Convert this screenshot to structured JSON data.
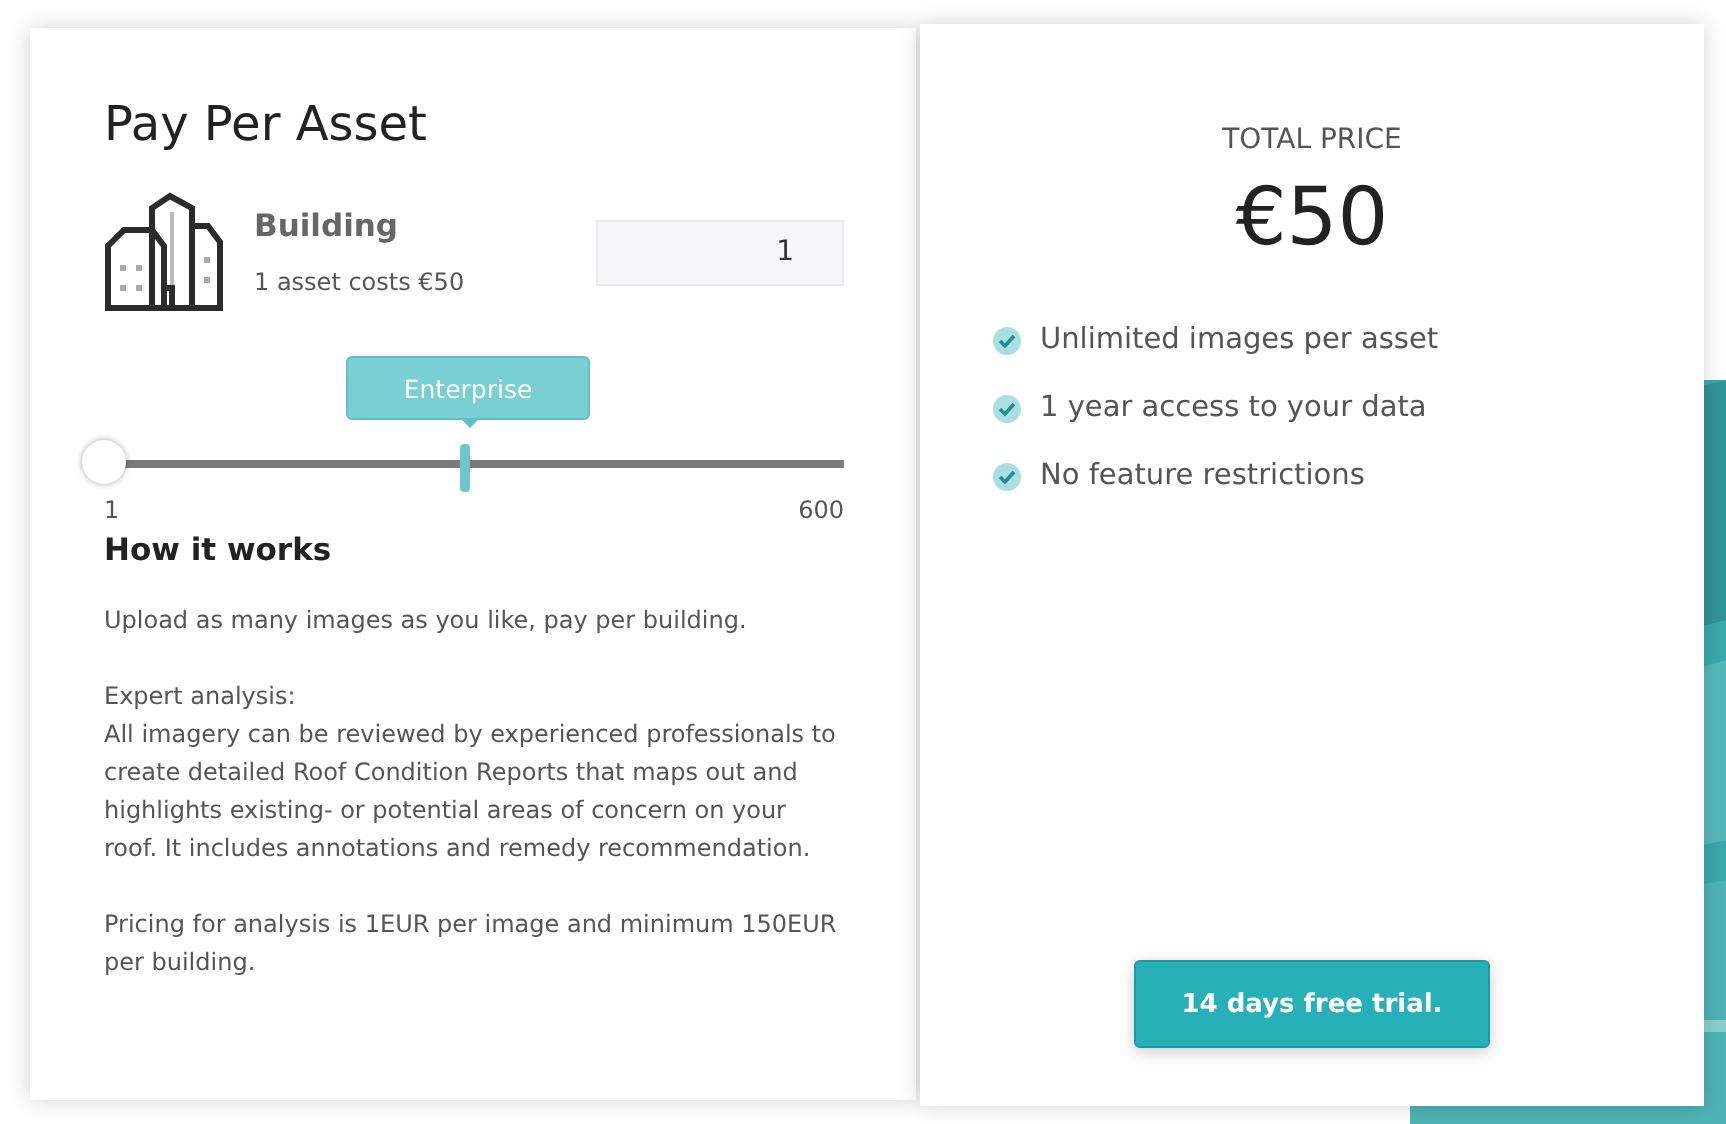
{
  "plan": {
    "title": "Pay Per Asset",
    "asset": {
      "name": "Building",
      "cost": "1 asset costs €50",
      "quantity": "1"
    },
    "slider": {
      "level": 0,
      "marker": "Enterprise",
      "min": "1",
      "max": "600"
    },
    "how_it_works": {
      "title": "How it works",
      "paragraphs": [
        "Upload as many images as you like, pay per building.",
        "Expert analysis:",
        "All imagery can be reviewed by experienced professionals to create detailed Roof Condition Reports that maps out and highlights existing- or potential areas of concern on your roof. It includes annotations and remedy recommendation.",
        "Pricing for analysis is 1EUR per image and minimum 150EUR per building."
      ]
    }
  },
  "summary": {
    "label": "TOTAL PRICE",
    "price": "€50",
    "features": [
      {
        "text": "Unlimited images per asset",
        "checked": true
      },
      {
        "text": "1 year access to your data",
        "checked": true
      },
      {
        "text": "No feature restrictions",
        "checked": true
      }
    ],
    "button": "14 days free trial."
  }
}
